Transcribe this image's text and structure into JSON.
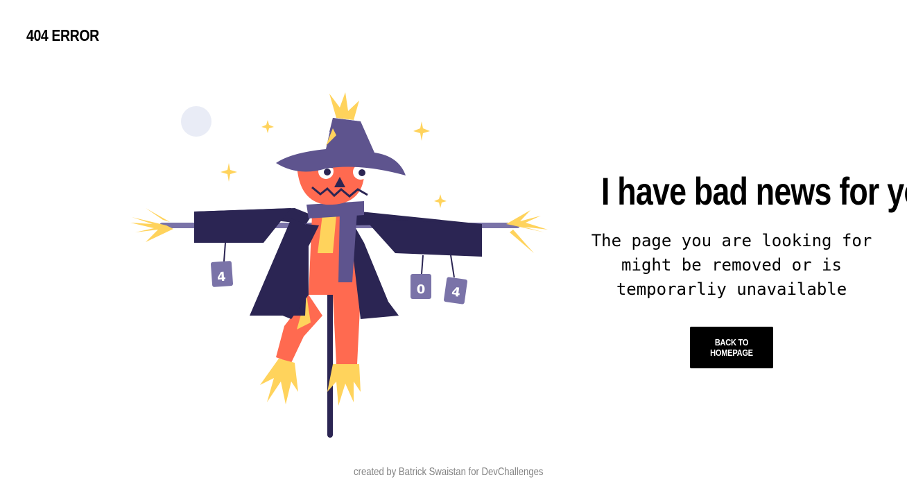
{
  "brand": {
    "title": "404 ERROR"
  },
  "illustration": {
    "can_labels": [
      "4",
      "0",
      "4"
    ]
  },
  "main": {
    "headline": "I have bad news for you",
    "message": "The page you are looking for might be removed or is temporarliy unavailable",
    "button_label": "BACK TO HOMEPAGE"
  },
  "footer": {
    "credit": "created by Batrick Swaistan for DevChallenges"
  },
  "colors": {
    "accent": "#000000",
    "footer_text": "#828282",
    "hat": "#5e548e",
    "coat": "#2b2553",
    "face": "#ff6a50",
    "straw": "#ffd35c"
  }
}
